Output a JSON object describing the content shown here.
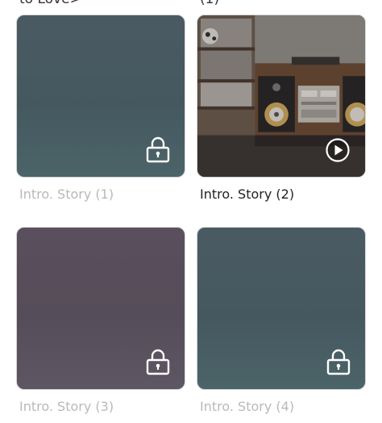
{
  "top_fragments": {
    "left": "to Love>",
    "right": "(1)"
  },
  "stories": [
    {
      "title": "Intro. Story (1)",
      "state": "locked",
      "icon": "lock-icon",
      "tint": "#455860"
    },
    {
      "title": "Intro. Story (2)",
      "state": "playable",
      "icon": "play-icon",
      "tint": "#6b5a4d"
    },
    {
      "title": "Intro. Story (3)",
      "state": "locked",
      "icon": "lock-icon",
      "tint": "#564d5a"
    },
    {
      "title": "Intro. Story (4)",
      "state": "locked",
      "icon": "lock-icon",
      "tint": "#455860"
    }
  ]
}
